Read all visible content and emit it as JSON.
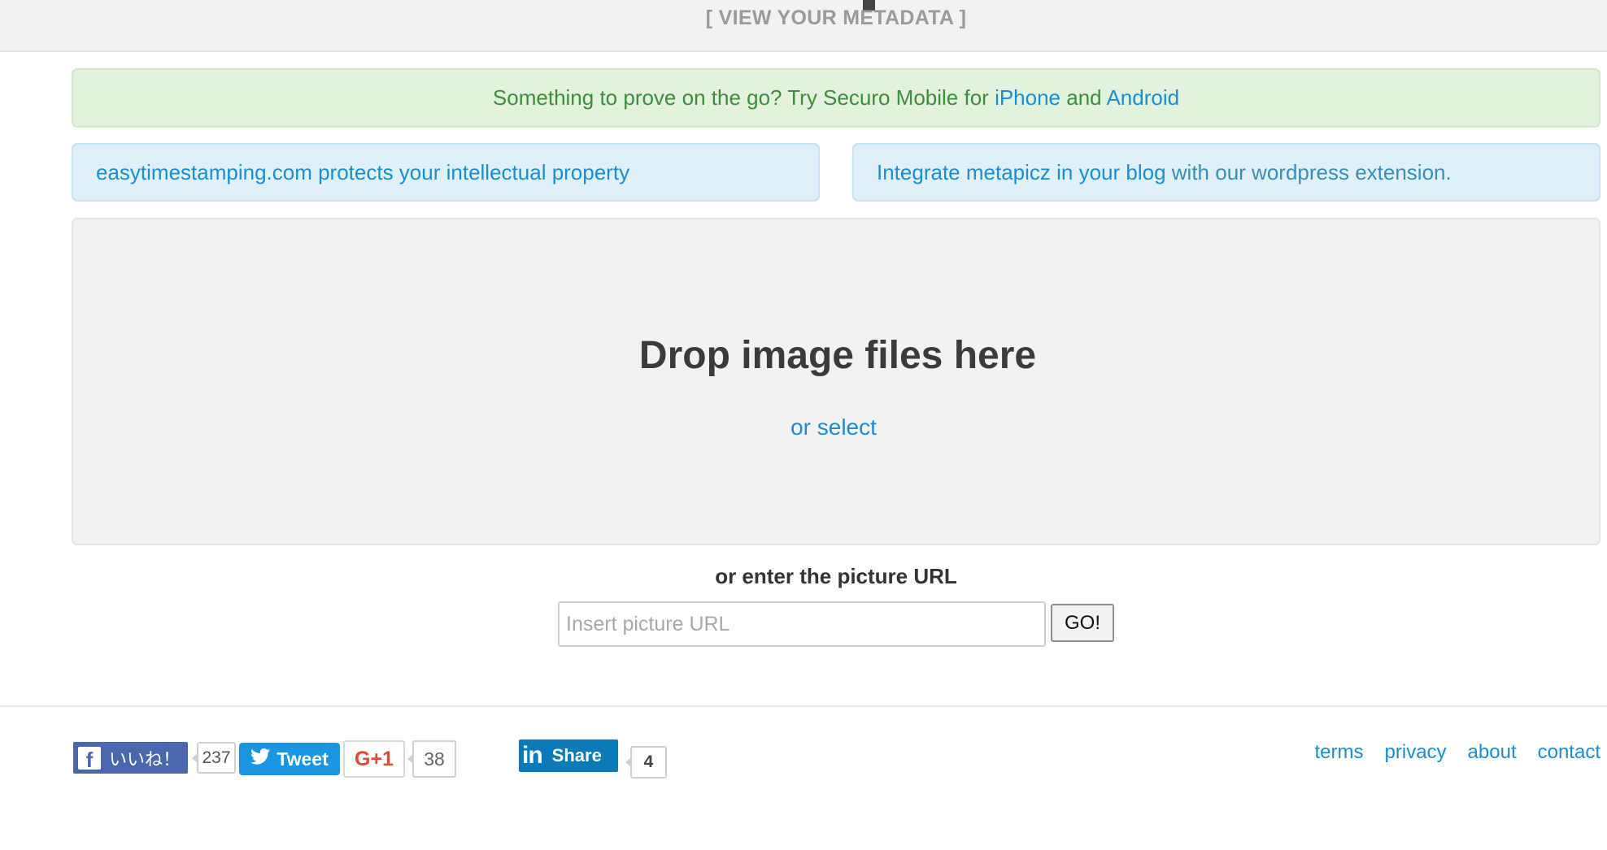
{
  "header": {
    "title": "[ VIEW YOUR METADATA ]"
  },
  "promo": {
    "mobile_text": "Something to prove on the go? Try Securo Mobile for",
    "iphone_link": "iPhone",
    "and_text": "and",
    "android_link": "Android"
  },
  "info_left": {
    "text": "easytimestamping.com protects your intellectual property"
  },
  "info_right": {
    "link": "Integrate metapicz in your blog",
    "text": "with our wordpress extension."
  },
  "dropzone": {
    "title": "Drop image files here",
    "select_link": "or select"
  },
  "url_form": {
    "label": "or enter the picture URL",
    "placeholder": "Insert picture URL",
    "value": "",
    "go_label": "GO!"
  },
  "social": {
    "facebook_label": "いいね！",
    "facebook_count": "237",
    "tweet_label": "Tweet",
    "gplus_label": "G+1",
    "gplus_count": "38",
    "linkedin_label": "Share",
    "linkedin_count": "4"
  },
  "footer_links": {
    "terms": "terms",
    "privacy": "privacy",
    "about": "about",
    "contact": "contact"
  },
  "colors": {
    "link": "#1a8ed0",
    "success_bg": "#e2f2dc",
    "info_bg": "#dff0f8",
    "facebook": "#4a67ad",
    "twitter": "#1b95e0",
    "gplus": "#dd4b39",
    "linkedin": "#0a7ab9"
  }
}
